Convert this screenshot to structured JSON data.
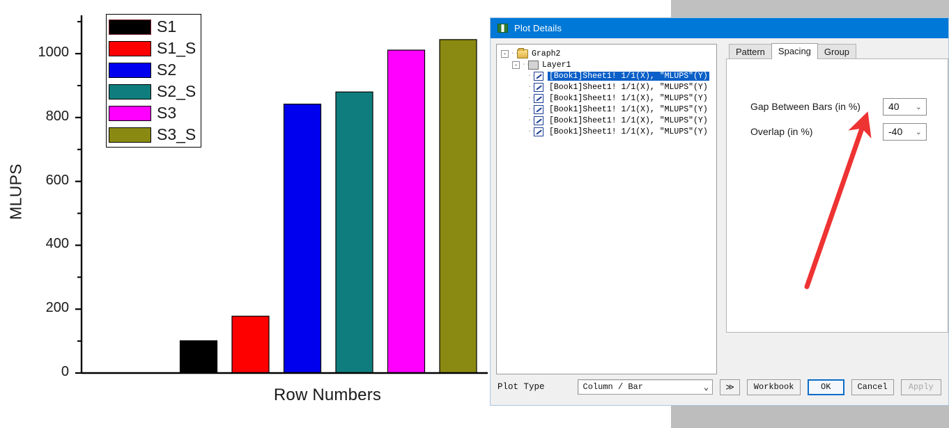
{
  "chart_data": {
    "type": "bar",
    "title": "",
    "xlabel": "Row Numbers",
    "ylabel": "MLUPS",
    "categories": [
      "S1",
      "S1_S",
      "S2",
      "S2_S",
      "S3",
      "S3_S"
    ],
    "values": [
      101,
      178,
      842,
      880,
      1011,
      1044
    ],
    "colors": [
      "#000000",
      "#ff0000",
      "#0000ee",
      "#0f7d7d",
      "#ff00ff",
      "#8a8a12"
    ],
    "ylim": [
      0,
      1120
    ],
    "yticks": [
      0,
      200,
      400,
      600,
      800,
      1000
    ],
    "ytick_labels": [
      "0",
      "200",
      "400",
      "600",
      "800",
      "1000"
    ],
    "minor_ticks": [
      100,
      300,
      500,
      700,
      900,
      1100
    ],
    "grid": false,
    "legend_position": "top-left",
    "legend_entries": [
      {
        "label": "S1",
        "color": "#000000"
      },
      {
        "label": "S1_S",
        "color": "#ff0000"
      },
      {
        "label": "S2",
        "color": "#0000ee"
      },
      {
        "label": "S2_S",
        "color": "#0f7d7d"
      },
      {
        "label": "S3",
        "color": "#ff00ff"
      },
      {
        "label": "S3_S",
        "color": "#8a8a12"
      }
    ]
  },
  "dialog": {
    "title": "Plot Details",
    "tree": {
      "root_label": "Graph2",
      "layer_label": "Layer1",
      "plots": [
        {
          "label": "[Book1]Sheet1! 1/1(X),  \"MLUPS\"(Y)",
          "selected": true
        },
        {
          "label": "[Book1]Sheet1! 1/1(X),  \"MLUPS\"(Y)",
          "selected": false
        },
        {
          "label": "[Book1]Sheet1! 1/1(X),  \"MLUPS\"(Y)",
          "selected": false
        },
        {
          "label": "[Book1]Sheet1! 1/1(X),  \"MLUPS\"(Y)",
          "selected": false
        },
        {
          "label": "[Book1]Sheet1! 1/1(X),  \"MLUPS\"(Y)",
          "selected": false
        },
        {
          "label": "[Book1]Sheet1! 1/1(X),  \"MLUPS\"(Y)",
          "selected": false
        }
      ],
      "expand_root": "-",
      "expand_layer": "-"
    },
    "tabs": [
      {
        "label": "Pattern",
        "active": false
      },
      {
        "label": "Spacing",
        "active": true
      },
      {
        "label": "Group",
        "active": false
      }
    ],
    "spacing": {
      "gap_label": "Gap Between Bars (in %)",
      "gap_value": "40",
      "overlap_label": "Overlap (in %)",
      "overlap_value": "-40",
      "chevron": "⌄"
    },
    "footer": {
      "plot_type_label": "Plot Type",
      "plot_type_value": "Column / Bar",
      "plot_type_chevron": "⌄",
      "expand_button": "≫",
      "workbook_button": "Workbook",
      "ok_button": "OK",
      "cancel_button": "Cancel",
      "apply_button": "Apply"
    }
  },
  "annotation": {
    "arrow_color": "#ee3333"
  }
}
